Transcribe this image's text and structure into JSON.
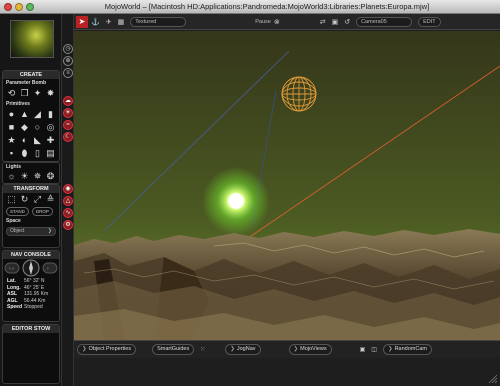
{
  "window": {
    "title": "MojoWorld – [Macintosh HD:Applications:Pandromeda:MojoWorld3:Libraries:Planets:Europa.mjw]"
  },
  "colors": {
    "toolbar_active": "#b92222",
    "sky_top": "#3b3e1a",
    "sky_horizon": "#6f8a2e",
    "sun": "#ffffff",
    "sun_glow": "#7fe03a",
    "gizmo": "#e09a3a"
  },
  "sidebar": {
    "create": {
      "title": "CREATE",
      "parameter_bomb": {
        "label": "Parameter Bomb",
        "icons": [
          "spiral-icon",
          "clone-icon",
          "wand-icon",
          "explode-icon",
          "scatter-icon"
        ]
      },
      "primitives": {
        "label": "Primitives",
        "icons": [
          "sphere-icon",
          "cone-icon",
          "pyramid-icon",
          "cylinder-icon",
          "cube-icon",
          "drop-icon",
          "ring-icon",
          "torus-icon",
          "star-icon",
          "disc-icon",
          "wedge-icon",
          "cross-icon",
          "block-icon",
          "capsule-icon",
          "tube-icon",
          "sheet-icon"
        ]
      },
      "lights": {
        "label": "Lights",
        "icons": [
          "bulb-icon",
          "sun-light-icon",
          "spot-light-icon",
          "area-light-icon"
        ]
      }
    },
    "transform": {
      "title": "TRANSFORM",
      "icons": [
        "move-icon",
        "rotate-icon",
        "scale-icon",
        "align-icon",
        "snap-icon"
      ],
      "stand_label": "STAND",
      "drop_label": "DROP",
      "space_label": "Space",
      "space_value": "Object"
    },
    "nav_console": {
      "title": "NAV CONSOLE",
      "lat_label": "Lat.",
      "lat_value": "56° 32' N",
      "long_label": "Long.",
      "long_value": "46° 25' E",
      "asl_label": "ASL",
      "asl_value": "131.95 Km",
      "agl_label": "AGL",
      "agl_value": "56.44 Km",
      "speed_label": "Speed",
      "speed_value": "Stopped"
    },
    "editor_stow": {
      "title": "EDITOR STOW"
    }
  },
  "toolbar": {
    "render_mode": "Textured",
    "pause_label": "Pause",
    "camera_value": "Camera05",
    "edit_label": "EDIT"
  },
  "bottombar": {
    "object_properties": "Object Properties",
    "smart_guides": "SmartGuides",
    "jog_nav": "JogNav",
    "mojo_views": "MojoViews",
    "random_cam": "RandomCam"
  }
}
